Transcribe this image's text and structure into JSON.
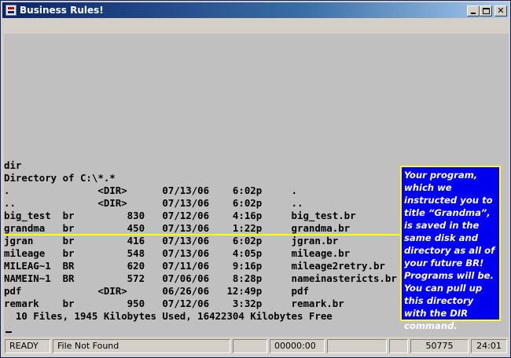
{
  "window": {
    "title": "Business Rules!"
  },
  "console": {
    "lines": [
      "dir",
      "Directory of C:\\*.*",
      ".               <DIR>      07/13/06    6:02p     .",
      "..              <DIR>      07/13/06    6:02p     ..",
      "big_test  br         830   07/12/06    4:16p     big_test.br",
      "grandma   br         450   07/13/06    1:22p     grandma.br",
      "jgran     br         416   07/13/06    6:02p     jgran.br",
      "mileage   br         548   07/13/06    4:05p     mileage.br",
      "MILEAG~1  BR         620   07/11/06    9:16p     mileage2retry.br",
      "NAMEIN~1  BR         572   07/06/06    8:28p     nameinastericts.br",
      "pdf             <DIR>      06/26/06   12:49p     pdf",
      "remark    br         950   07/12/06    3:32p     remark.br",
      "  10 Files, 1945 Kilobytes Used, 16422304 Kilobytes Free"
    ]
  },
  "callout": {
    "text": "Your program, which we instructed you to title “Grandma”, is saved in the same disk and directory as all of your future BR! Programs will be. You can pull up this directory with the DIR command."
  },
  "statusbar": {
    "ready": "READY",
    "message": "File Not Found",
    "empty1": "",
    "time": "00000:00",
    "empty2": "",
    "empty3": "",
    "number": "50775",
    "clock": "24:01"
  },
  "colors": {
    "console_bg": "#c0c0c0",
    "callout_bg": "#0000ee",
    "callout_border": "#ffff00",
    "highlight_line": "#ffff00",
    "titlebar": "#0a246a"
  }
}
